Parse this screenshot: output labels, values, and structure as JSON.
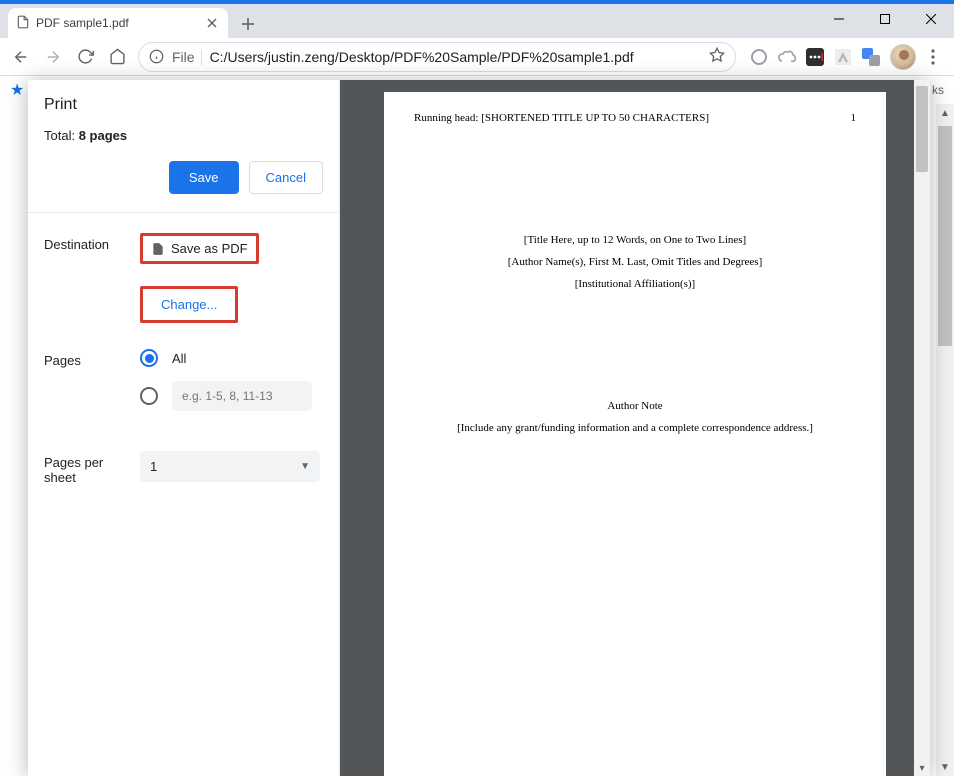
{
  "window": {
    "minimize": "—",
    "maximize": "▢",
    "close": "✕"
  },
  "tab": {
    "title": "PDF sample1.pdf"
  },
  "toolbar": {
    "file_label": "File",
    "url": "C:/Users/justin.zeng/Desktop/PDF%20Sample/PDF%20sample1.pdf"
  },
  "bookmarks": {
    "right_label": "ks"
  },
  "print": {
    "title": "Print",
    "total_prefix": "Total: ",
    "total_count": "8 pages",
    "save_label": "Save",
    "cancel_label": "Cancel",
    "destination_label": "Destination",
    "destination_value": "Save as PDF",
    "change_label": "Change...",
    "pages_label": "Pages",
    "pages_all": "All",
    "pages_range_placeholder": "e.g. 1-5, 8, 11-13",
    "pps_label": "Pages per sheet",
    "pps_value": "1"
  },
  "document": {
    "running_head": "Running head: [SHORTENED TITLE UP TO 50 CHARACTERS]",
    "page_num": "1",
    "title_line": "[Title Here, up to 12 Words, on One to Two Lines]",
    "author_line": "[Author Name(s), First M. Last, Omit Titles and Degrees]",
    "affiliation_line": "[Institutional Affiliation(s)]",
    "author_note_heading": "Author Note",
    "author_note_body": "[Include any grant/funding information and a complete correspondence address.]"
  }
}
